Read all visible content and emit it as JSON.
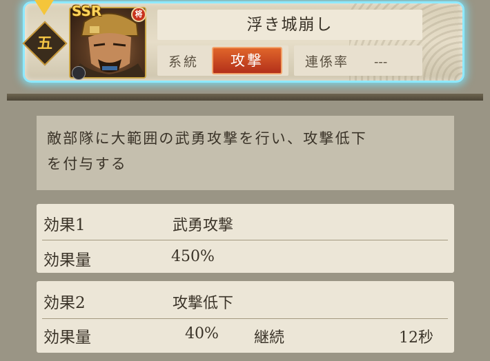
{
  "header": {
    "rank": "五",
    "rarity": "SSR",
    "general_badge": "将",
    "skill_name": "浮き城崩し",
    "type_label": "系統",
    "type_value": "攻撃",
    "link_label": "連係率",
    "link_value": "---"
  },
  "description": {
    "line1": "敵部隊に大範囲の武勇攻撃を行い、攻撃低下",
    "line2": "を付与する"
  },
  "effects": [
    {
      "label": "効果1",
      "name": "武勇攻撃",
      "amount_label": "効果量",
      "amount": "450%"
    },
    {
      "label": "効果2",
      "name": "攻撃低下",
      "amount_label": "効果量",
      "amount": "40%",
      "duration_label": "継続",
      "duration": "12秒"
    }
  ],
  "colors": {
    "banner_glow": "#8ee9ff",
    "type_chip": "#c9401f",
    "rarity": "#ffd45a"
  }
}
